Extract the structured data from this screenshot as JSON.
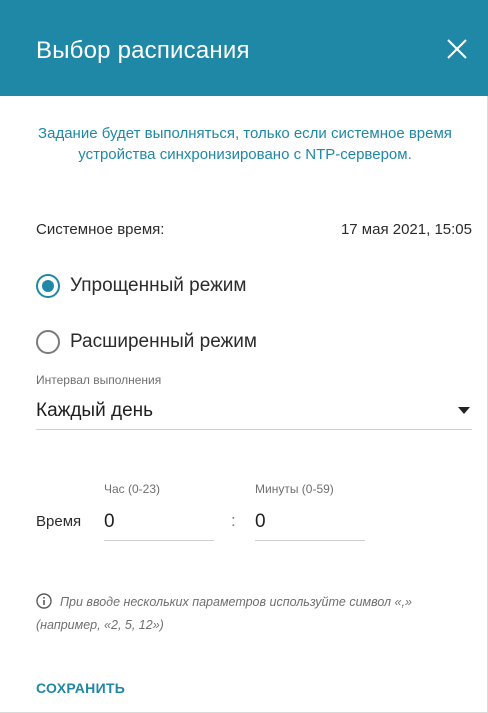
{
  "dialog": {
    "title": "Выбор расписания",
    "close_icon": "close-icon"
  },
  "notice": "Задание будет выполняться, только если системное время устройства синхронизировано с NTP-сервером.",
  "system_time": {
    "label": "Системное время:",
    "value": "17 мая 2021, 15:05"
  },
  "mode": {
    "options": [
      {
        "label": "Упрощенный режим",
        "checked": true
      },
      {
        "label": "Расширенный режим",
        "checked": false
      }
    ]
  },
  "interval": {
    "label": "Интервал выполнения",
    "value": "Каждый день"
  },
  "time": {
    "label": "Время",
    "hour_label": "Час (0-23)",
    "hour_value": "0",
    "separator": ":",
    "minute_label": "Минуты (0-59)",
    "minute_value": "0"
  },
  "info": {
    "icon": "info-icon",
    "text": "При вводе нескольких параметров используйте символ «,» (например, «2, 5, 12»)"
  },
  "actions": {
    "save_label": "СОХРАНИТЬ"
  },
  "colors": {
    "accent": "#1f88a6",
    "header_bg": "#1f88a6",
    "text": "#2b2b2b",
    "muted": "#6f6f6f"
  }
}
